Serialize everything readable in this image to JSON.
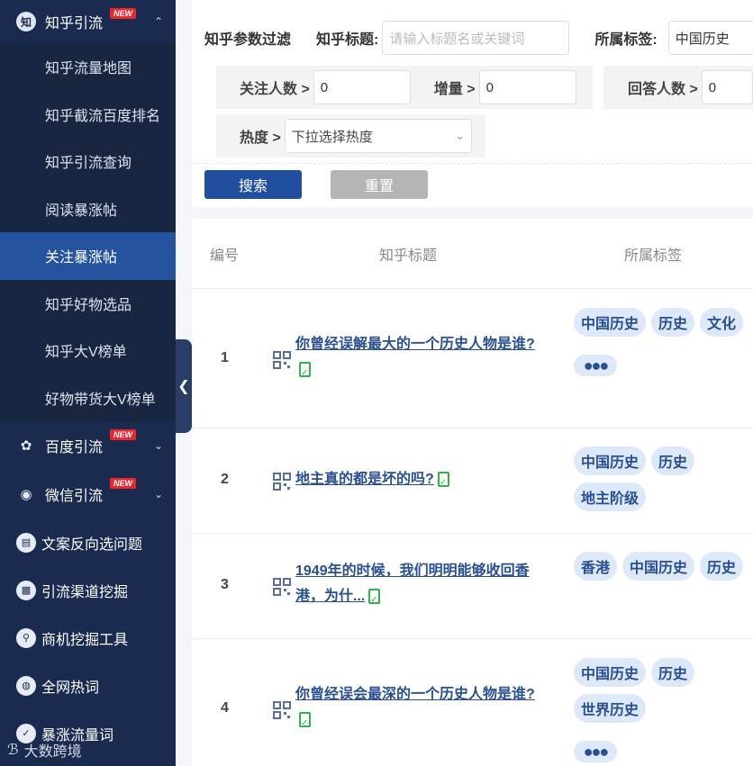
{
  "sidebar": {
    "top_group": {
      "label": "知乎引流",
      "badge": "NEW",
      "icon": "zhihu-icon",
      "icon_text": "知"
    },
    "sub_items": [
      {
        "label": "知乎流量地图",
        "active": false
      },
      {
        "label": "知乎截流百度排名",
        "active": false
      },
      {
        "label": "知乎引流查询",
        "active": false
      },
      {
        "label": "阅读暴涨帖",
        "active": false
      },
      {
        "label": "关注暴涨帖",
        "active": true
      },
      {
        "label": "知乎好物选品",
        "active": false
      },
      {
        "label": "知乎大V榜单",
        "active": false
      },
      {
        "label": "好物带货大V榜单",
        "active": false
      }
    ],
    "groups": [
      {
        "label": "百度引流",
        "badge": "NEW",
        "icon": "paw-icon"
      },
      {
        "label": "微信引流",
        "badge": "NEW",
        "icon": "wechat-icon"
      }
    ],
    "items": [
      {
        "label": "文案反向选问题",
        "icon": "document-icon"
      },
      {
        "label": "引流渠道挖掘",
        "icon": "monitor-icon"
      },
      {
        "label": "商机挖掘工具",
        "icon": "search-icon"
      },
      {
        "label": "全网热词",
        "icon": "hot-icon"
      },
      {
        "label": "暴涨流量词",
        "icon": "check-icon"
      }
    ],
    "watermark": "大数跨境"
  },
  "filter": {
    "section_title": "知乎参数过滤",
    "title_label": "知乎标题:",
    "title_placeholder": "请输入标题名或关键词",
    "tag_label": "所属标签:",
    "tag_value": "中国历史",
    "followers_label": "关注人数 >",
    "followers_value": "0",
    "increase_label": "增量 >",
    "increase_value": "0",
    "answers_label": "回答人数 >",
    "answers_value": "0",
    "heat_label": "热度 >",
    "heat_placeholder": "下拉选择热度",
    "search_button": "搜索",
    "reset_button": "重置"
  },
  "table": {
    "headers": {
      "num": "编号",
      "title": "知乎标题",
      "tags": "所属标签"
    },
    "rows": [
      {
        "num": "1",
        "title": "你曾经误解最大的一个历史人物是谁?",
        "tags": [
          "中国历史",
          "历史",
          "文化"
        ],
        "more": true
      },
      {
        "num": "2",
        "title": "地主真的都是坏的吗?",
        "tags": [
          "中国历史",
          "历史",
          "地主阶级"
        ],
        "more": false
      },
      {
        "num": "3",
        "title": "1949年的时候，我们明明能够收回香港，为什...",
        "tags": [
          "香港",
          "中国历史",
          "历史"
        ],
        "more": false
      },
      {
        "num": "4",
        "title": "你曾经误会最深的一个历史人物是谁?",
        "tags": [
          "中国历史",
          "历史",
          "世界历史"
        ],
        "more": true
      }
    ]
  }
}
